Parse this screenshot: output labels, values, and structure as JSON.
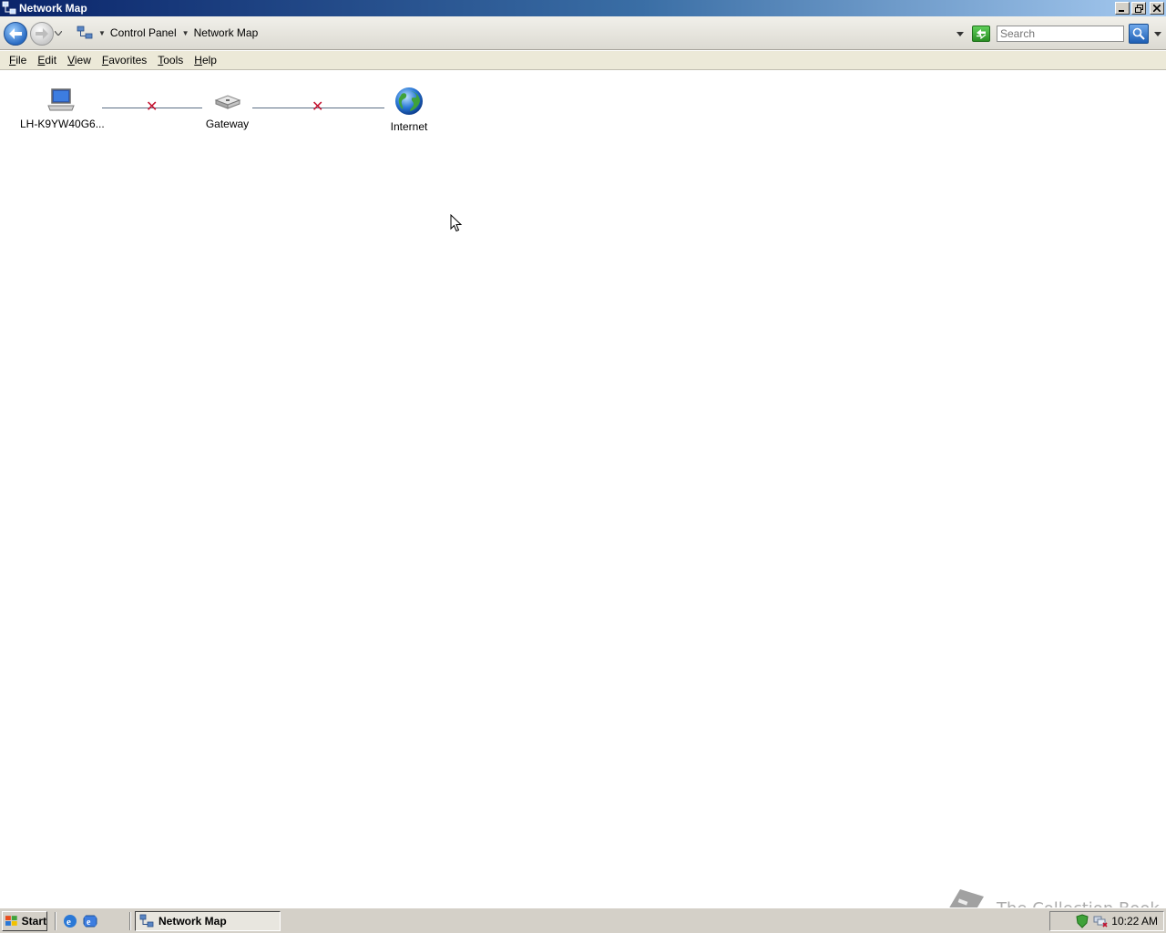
{
  "window": {
    "title": "Network Map"
  },
  "address_bar": {
    "crumbs": [
      "Control Panel",
      "Network Map"
    ],
    "search_placeholder": "Search"
  },
  "menu": {
    "items": [
      {
        "label": "File",
        "accel": "F",
        "rest": "ile"
      },
      {
        "label": "Edit",
        "accel": "E",
        "rest": "dit"
      },
      {
        "label": "View",
        "accel": "V",
        "rest": "iew"
      },
      {
        "label": "Favorites",
        "accel": "F",
        "rest": "avorites"
      },
      {
        "label": "Tools",
        "accel": "T",
        "rest": "ools"
      },
      {
        "label": "Help",
        "accel": "H",
        "rest": "elp"
      }
    ]
  },
  "network_map": {
    "nodes": [
      {
        "label": "LH-K9YW40G6...",
        "icon": "computer-icon"
      },
      {
        "label": "Gateway",
        "icon": "gateway-icon"
      },
      {
        "label": "Internet",
        "icon": "internet-globe-icon"
      }
    ],
    "links": [
      {
        "from": "LH-K9YW40G6...",
        "to": "Gateway",
        "status": "disconnected"
      },
      {
        "from": "Gateway",
        "to": "Internet",
        "status": "disconnected"
      }
    ],
    "disconnect_color": "#c4122f"
  },
  "taskbar": {
    "start_label": "Start",
    "task_label": "Network Map",
    "clock": "10:22 AM"
  },
  "watermark": {
    "text": "The Collection Book"
  },
  "colors": {
    "title_bar_start": "#0a246a",
    "title_bar_end": "#a6caf0",
    "taskbar": "#d4d0c8"
  }
}
